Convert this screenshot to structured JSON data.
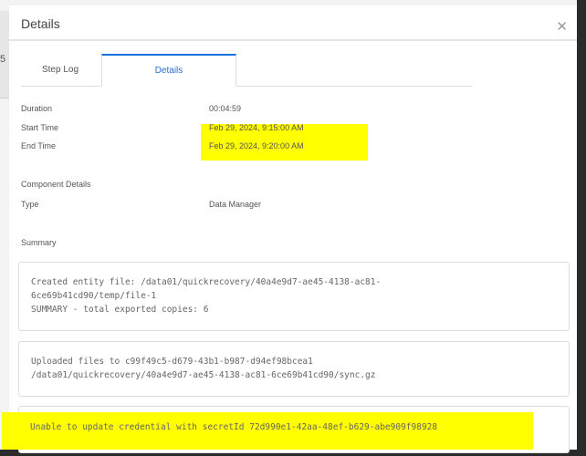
{
  "background": {
    "partial_text": "5"
  },
  "dialog": {
    "title": "Details",
    "tabs": [
      {
        "label": "Step Log",
        "active": false
      },
      {
        "label": "Details",
        "active": true
      }
    ],
    "fields": [
      {
        "label": "Duration",
        "value": "00:04:59"
      },
      {
        "label": "Start Time",
        "value": "Feb 29, 2024, 9:15:00 AM"
      },
      {
        "label": "End Time",
        "value": "Feb 29, 2024, 9:20:00 AM"
      }
    ],
    "component_heading": "Component Details",
    "component_fields": [
      {
        "label": "Type",
        "value": "Data Manager"
      }
    ],
    "summary_heading": "Summary",
    "summary_entries": [
      {
        "lines": [
          "Created entity file: /data01/quickrecovery/40a4e9d7-ae45-4138-ac81-",
          "6ce69b41cd90/temp/file-1",
          "SUMMARY - total exported copies: 6"
        ]
      },
      {
        "lines": [
          "Uploaded files to c99f49c5-d679-43b1-b987-d94ef98bcea1",
          "/data01/quickrecovery/40a4e9d7-ae45-4138-ac81-6ce69b41cd90/sync.gz"
        ]
      },
      {
        "lines": [
          "Unable to update credential with secretId 72d990e1-42aa-48ef-b629-abe909f98928"
        ]
      }
    ]
  },
  "colors": {
    "accent": "#1a73d9",
    "highlight": "#ffff00"
  }
}
